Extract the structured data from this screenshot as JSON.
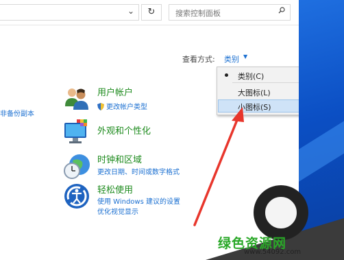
{
  "toolbar": {
    "search_placeholder": "搜索控制面板",
    "refresh_glyph": "↻",
    "address_chevron": "⌄"
  },
  "view": {
    "label": "查看方式:",
    "current": "类别",
    "menu": [
      {
        "label": "类别(C)",
        "selected": true
      },
      {
        "label": "大图标(L)",
        "selected": false
      },
      {
        "label": "小图标(S)",
        "selected": false,
        "highlighted": true
      }
    ]
  },
  "left_link": "非备份副本",
  "categories": [
    {
      "title": "用户帐户",
      "links": [
        "更改帐户类型"
      ]
    },
    {
      "title": "外观和个性化",
      "links": []
    },
    {
      "title": "时钟和区域",
      "links": [
        "更改日期、时间或数字格式"
      ]
    },
    {
      "title": "轻松使用",
      "links": [
        "使用 Windows 建议的设置",
        "优化视觉显示"
      ]
    }
  ],
  "watermark": {
    "text": "绿色资源网",
    "url": "www.54092.com"
  },
  "colors": {
    "accent_link": "#1a6fd1",
    "category_title": "#1c8a1c",
    "arrow": "#e8362c"
  }
}
